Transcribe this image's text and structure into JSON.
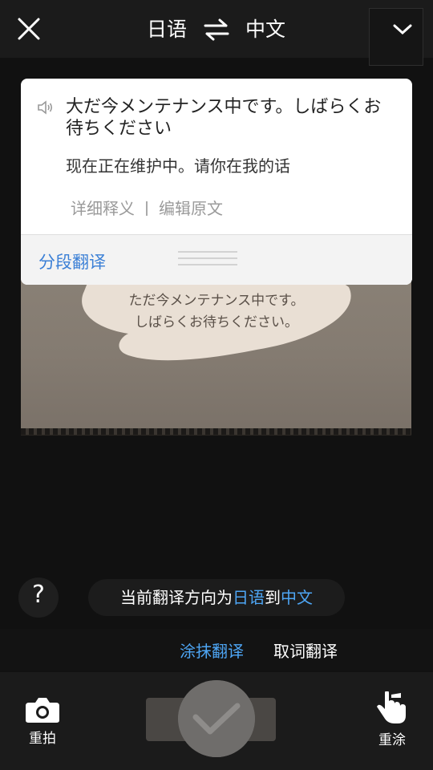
{
  "header": {
    "source_language": "日语",
    "target_language": "中文",
    "close_icon": "close-icon",
    "swap_icon": "swap-arrows-icon",
    "expand_icon": "chevron-down-icon"
  },
  "photo": {
    "text_line1": "ただ今メンテナンス中です。",
    "text_line2": "しばらくお待ちください。"
  },
  "popup": {
    "source_text": "大だ今メンテナンス中です。しばらくお待ちください",
    "translation": "现在正在维护中。请你在我的话",
    "detail_link": "详细释义",
    "edit_link": "编辑原文",
    "segment_button": "分段翻译"
  },
  "hint": {
    "prefix": "当前翻译方向为",
    "from": "日语",
    "middle": "到",
    "to": "中文"
  },
  "modes": {
    "smear": "涂抹翻译",
    "word": "取词翻译"
  },
  "bottom": {
    "retake_label": "重拍",
    "redraw_label": "重涂"
  },
  "colors": {
    "accent": "#4ea6f5",
    "link": "#3a7fd6"
  }
}
